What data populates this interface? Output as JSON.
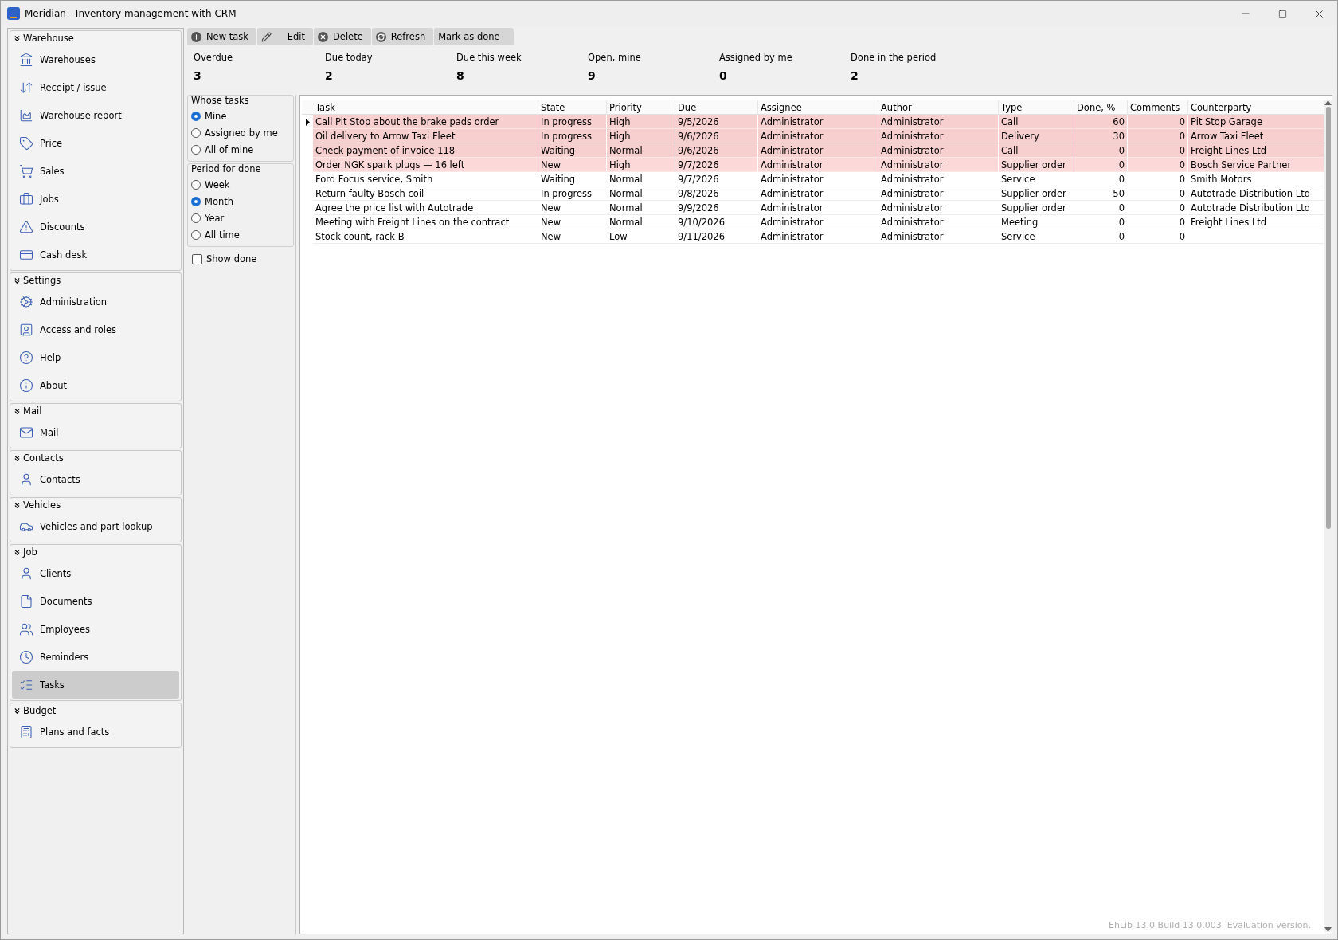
{
  "window": {
    "title": "Meridian - Inventory management with CRM"
  },
  "sidebar": {
    "groups": [
      {
        "title": "Warehouse",
        "items": [
          {
            "label": "Warehouses",
            "selected": false
          },
          {
            "label": "Receipt / issue",
            "selected": false
          },
          {
            "label": "Warehouse report",
            "selected": false
          },
          {
            "label": "Price",
            "selected": false
          },
          {
            "label": "Sales",
            "selected": false
          },
          {
            "label": "Jobs",
            "selected": false
          },
          {
            "label": "Discounts",
            "selected": false
          },
          {
            "label": "Cash desk",
            "selected": false
          }
        ]
      },
      {
        "title": "Settings",
        "items": [
          {
            "label": "Administration",
            "selected": false
          },
          {
            "label": "Access and roles",
            "selected": false
          },
          {
            "label": "Help",
            "selected": false
          },
          {
            "label": "About",
            "selected": false
          }
        ]
      },
      {
        "title": "Mail",
        "items": [
          {
            "label": "Mail",
            "selected": false
          }
        ]
      },
      {
        "title": "Contacts",
        "items": [
          {
            "label": "Contacts",
            "selected": false
          }
        ]
      },
      {
        "title": "Vehicles",
        "items": [
          {
            "label": "Vehicles and part lookup",
            "selected": false
          }
        ]
      },
      {
        "title": "Job",
        "items": [
          {
            "label": "Clients",
            "selected": false
          },
          {
            "label": "Documents",
            "selected": false
          },
          {
            "label": "Employees",
            "selected": false
          },
          {
            "label": "Reminders",
            "selected": false
          },
          {
            "label": "Tasks",
            "selected": true
          }
        ]
      },
      {
        "title": "Budget",
        "items": [
          {
            "label": "Plans and facts",
            "selected": false
          }
        ]
      }
    ]
  },
  "toolbar": [
    "New task",
    "Edit",
    "Delete",
    "Refresh",
    "Mark as done"
  ],
  "stats": [
    {
      "label": "Overdue",
      "value": "3"
    },
    {
      "label": "Due today",
      "value": "2"
    },
    {
      "label": "Due this week",
      "value": "8"
    },
    {
      "label": "Open, mine",
      "value": "9"
    },
    {
      "label": "Assigned by me",
      "value": "0"
    },
    {
      "label": "Done in the period",
      "value": "2"
    }
  ],
  "filters": {
    "whose_tasks": {
      "title": "Whose tasks",
      "options": [
        {
          "label": "Mine",
          "selected": true
        },
        {
          "label": "Assigned by me",
          "selected": false
        },
        {
          "label": "All of mine",
          "selected": false
        }
      ]
    },
    "period": {
      "title": "Period for done",
      "options": [
        {
          "label": "Week",
          "selected": false
        },
        {
          "label": "Month",
          "selected": true
        },
        {
          "label": "Year",
          "selected": false
        },
        {
          "label": "All time",
          "selected": false
        }
      ]
    },
    "show_done": {
      "label": "Show done",
      "checked": false
    }
  },
  "table": {
    "columns": [
      "Task",
      "State",
      "Priority",
      "Due",
      "Assignee",
      "Author",
      "Type",
      "Done, %",
      "Comments",
      "Counterparty"
    ],
    "rows": [
      {
        "selected": true,
        "color": "#f8cfcf",
        "cells": [
          "Call Pit Stop about the brake pads order",
          "In progress",
          "High",
          "9/5/2026",
          "Administrator",
          "Administrator",
          "Call",
          "60",
          "0",
          "Pit Stop Garage"
        ]
      },
      {
        "selected": false,
        "color": "#f8cfcf",
        "cells": [
          "Oil delivery to Arrow Taxi Fleet",
          "In progress",
          "High",
          "9/6/2026",
          "Administrator",
          "Administrator",
          "Delivery",
          "30",
          "0",
          "Arrow Taxi Fleet"
        ]
      },
      {
        "selected": false,
        "color": "#f8cfcf",
        "cells": [
          "Check payment of invoice 118",
          "Waiting",
          "Normal",
          "9/6/2026",
          "Administrator",
          "Administrator",
          "Call",
          "0",
          "0",
          "Freight Lines Ltd"
        ]
      },
      {
        "selected": false,
        "color": "#fdd8d8",
        "cells": [
          "Order NGK spark plugs — 16 left",
          "New",
          "High",
          "9/7/2026",
          "Administrator",
          "Administrator",
          "Supplier order",
          "0",
          "0",
          "Bosch Service Partner"
        ]
      },
      {
        "selected": false,
        "color": "#ffffff",
        "cells": [
          "Ford Focus service, Smith",
          "Waiting",
          "Normal",
          "9/7/2026",
          "Administrator",
          "Administrator",
          "Service",
          "0",
          "0",
          "Smith Motors"
        ]
      },
      {
        "selected": false,
        "color": "#ffffff",
        "cells": [
          "Return faulty Bosch coil",
          "In progress",
          "Normal",
          "9/8/2026",
          "Administrator",
          "Administrator",
          "Supplier order",
          "50",
          "0",
          "Autotrade Distribution Ltd"
        ]
      },
      {
        "selected": false,
        "color": "#ffffff",
        "cells": [
          "Agree the price list with Autotrade",
          "New",
          "Normal",
          "9/9/2026",
          "Administrator",
          "Administrator",
          "Supplier order",
          "0",
          "0",
          "Autotrade Distribution Ltd"
        ]
      },
      {
        "selected": false,
        "color": "#ffffff",
        "cells": [
          "Meeting with Freight Lines on the contract",
          "New",
          "Normal",
          "9/10/2026",
          "Administrator",
          "Administrator",
          "Meeting",
          "0",
          "0",
          "Freight Lines Ltd"
        ]
      },
      {
        "selected": false,
        "color": "#ffffff",
        "cells": [
          "Stock count, rack B",
          "New",
          "Low",
          "9/11/2026",
          "Administrator",
          "Administrator",
          "Service",
          "0",
          "0",
          ""
        ]
      }
    ],
    "footer_note": "EhLib 13.0 Build 13.0.003. Evaluation version."
  }
}
